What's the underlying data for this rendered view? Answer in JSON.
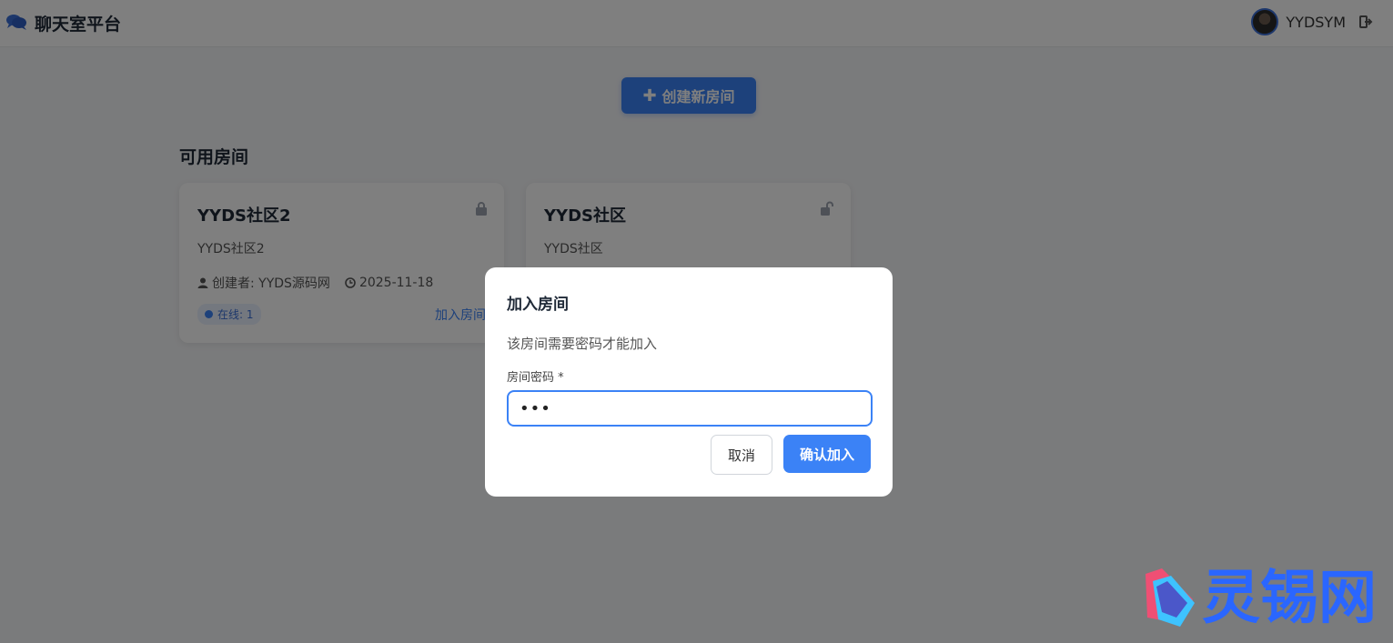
{
  "header": {
    "app_title": "聊天室平台",
    "username": "YYDSYM"
  },
  "main": {
    "create_button": "创建新房间",
    "section_title": "可用房间",
    "rooms": [
      {
        "name": "YYDS社区2",
        "description": "YYDS社区2",
        "creator": "创建者: YYDS源码网",
        "date": "2025-11-18",
        "online": "在线: 1",
        "join_label": "加入房间",
        "locked": true
      },
      {
        "name": "YYDS社区",
        "description": "YYDS社区",
        "locked": false
      }
    ]
  },
  "modal": {
    "title": "加入房间",
    "message": "该房间需要密码才能加入",
    "label": "房间密码 *",
    "password_mask": "•••",
    "cancel_label": "取消",
    "confirm_label": "确认加入"
  },
  "watermark": {
    "text": "灵锡网"
  },
  "colors": {
    "accent": "#3b82f6",
    "overlay": "rgba(0,0,0,0.5)"
  }
}
